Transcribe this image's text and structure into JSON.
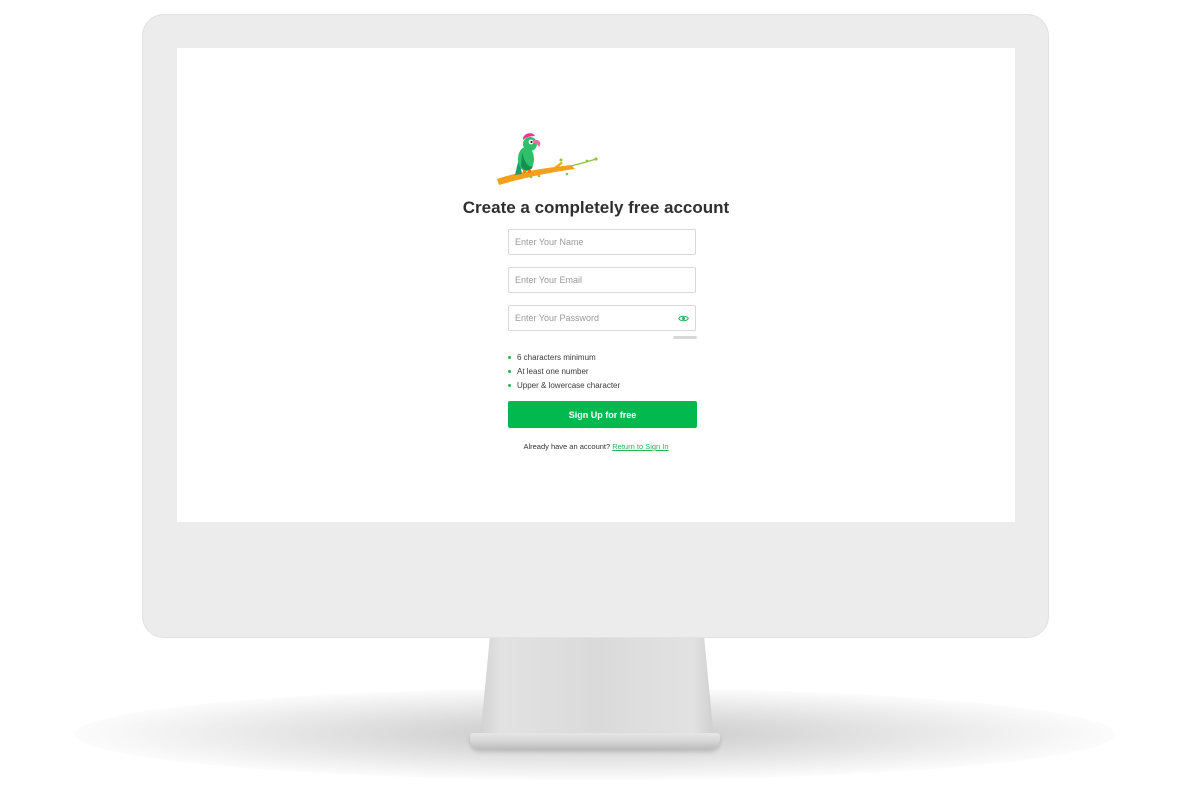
{
  "form": {
    "heading": "Create a completely free account",
    "name_placeholder": "Enter Your Name",
    "email_placeholder": "Enter Your Email",
    "password_placeholder": "Enter Your Password",
    "password_rules": [
      "6 characters minimum",
      "At least one number",
      "Upper & lowercase character"
    ],
    "submit_label": "Sign Up for free",
    "signin_prompt": "Already have an account?",
    "signin_link": "Return to Sign In"
  },
  "icons": {
    "logo": "parrot-on-branch-logo",
    "password_toggle": "eye-icon"
  },
  "colors": {
    "accent": "#02b950",
    "link": "#1fb35a",
    "bullet": "#22b14c",
    "bezel": "#ececec"
  }
}
